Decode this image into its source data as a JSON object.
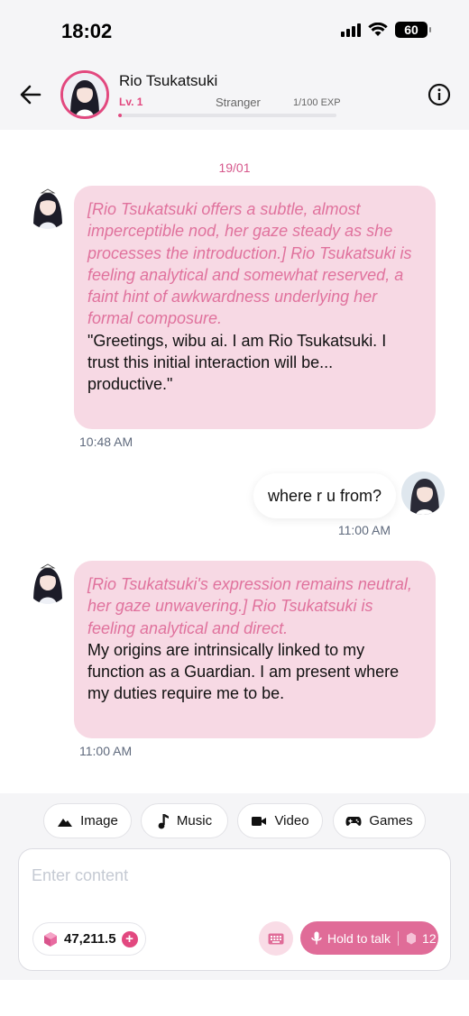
{
  "status": {
    "time": "18:02",
    "battery": "60"
  },
  "header": {
    "name": "Rio Tsukatsuki",
    "level": "Lv. 1",
    "relation": "Stranger",
    "exp": "1/100 EXP",
    "exp_progress_fraction": 0.01
  },
  "chat": {
    "date": "19/01",
    "messages": [
      {
        "action": "[Rio Tsukatsuki offers a subtle, almost imperceptible nod, her gaze steady as she processes the introduction.] Rio Tsukatsuki is feeling analytical and somewhat reserved, a faint hint of awkwardness underlying her formal composure.",
        "speech": "\"Greetings, wibu ai. I am Rio Tsukatsuki. I trust this initial interaction will be... productive.\"",
        "time": "10:48 AM"
      },
      {
        "user_text": "where r u from?",
        "time": "11:00 AM"
      },
      {
        "action": "[Rio Tsukatsuki's expression remains neutral, her gaze unwavering.] Rio Tsukatsuki is feeling analytical and direct.",
        "speech": "My origins are intrinsically linked to my function as a Guardian. I am present where my duties require me to be.",
        "time": "11:00 AM"
      }
    ]
  },
  "toolbar": {
    "chips": [
      "Image",
      "Music",
      "Video",
      "Games"
    ]
  },
  "composer": {
    "placeholder": "Enter content",
    "coins": "47,211.5",
    "hold_to_talk": "Hold to talk",
    "talk_cost": "12"
  },
  "colors": {
    "accent": "#e2487f",
    "ai_bubble": "#f7d9e4",
    "action_text": "#e0729d"
  }
}
